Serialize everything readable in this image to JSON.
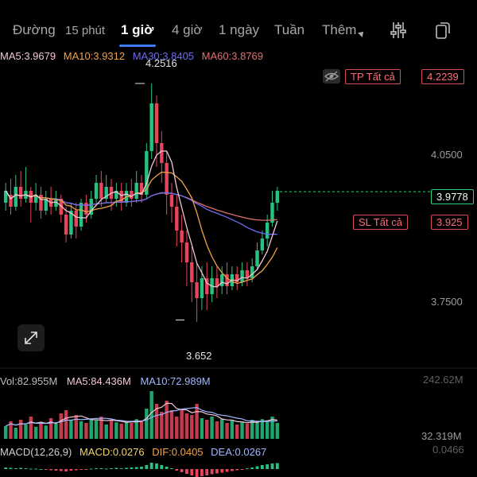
{
  "tabs": [
    {
      "label": "Đường",
      "active": false
    },
    {
      "label": "15 phút",
      "active": false
    },
    {
      "label": "1 giờ",
      "active": true
    },
    {
      "label": "4 giờ",
      "active": false
    },
    {
      "label": "1 ngày",
      "active": false
    },
    {
      "label": "Tuần",
      "active": false
    },
    {
      "label": "Thêm",
      "active": false
    }
  ],
  "toolbar_icons": [
    "indicator-settings-icon",
    "landscape-rotate-icon"
  ],
  "ma": {
    "ma5": "MA5:3.9679",
    "ma10": "MA10:3.9312",
    "ma30": "MA30:3.8405",
    "ma60": "MA60:3.8769"
  },
  "colors": {
    "up": "#26c281",
    "down": "#e8455a",
    "ma5": "#f2c7d6",
    "ma10": "#f0a347",
    "ma30": "#6f6cf0",
    "ma60": "#e06f6f",
    "accent": "#3d7bff",
    "current": "#2fd17c"
  },
  "orders": {
    "tp_label": "TP  Tất cả",
    "tp_price": "4.2239",
    "sl_label": "SL  Tất cả",
    "sl_price": "3.925"
  },
  "current_price": "3.9778",
  "price_axis": {
    "upper": "4.0500",
    "lower": "3.7500"
  },
  "high_label": "4.2516",
  "low_label": "3.652",
  "volume": {
    "vol": "Vol:82.955M",
    "ma5": "MA5:84.436M",
    "ma10": "MA10:72.989M",
    "axis_top": "242.62M",
    "axis_bottom": "32.319M"
  },
  "macd": {
    "label": "MACD(12,26,9)",
    "macd": "MACD:0.0276",
    "dif": "DIF:0.0405",
    "dea": "DEA:0.0267",
    "axis_top": "0.0466"
  },
  "chart_data": {
    "type": "candlestick",
    "y_range": [
      3.58,
      4.3
    ],
    "candles": [
      [
        3.95,
        3.98,
        3.93,
        4.0
      ],
      [
        3.97,
        3.94,
        3.92,
        4.01
      ],
      [
        3.94,
        3.99,
        3.93,
        4.02
      ],
      [
        3.99,
        3.96,
        3.94,
        4.03
      ],
      [
        3.96,
        3.98,
        3.95,
        4.04
      ],
      [
        3.98,
        3.95,
        3.9,
        3.99
      ],
      [
        3.95,
        3.97,
        3.93,
        4.0
      ],
      [
        3.97,
        3.93,
        3.91,
        3.99
      ],
      [
        3.93,
        3.96,
        3.92,
        3.98
      ],
      [
        3.96,
        3.94,
        3.92,
        3.99
      ],
      [
        3.94,
        3.96,
        3.93,
        3.98
      ],
      [
        3.96,
        3.92,
        3.9,
        3.97
      ],
      [
        3.92,
        3.87,
        3.85,
        3.94
      ],
      [
        3.87,
        3.93,
        3.86,
        3.95
      ],
      [
        3.93,
        3.89,
        3.86,
        3.95
      ],
      [
        3.89,
        3.95,
        3.88,
        3.96
      ],
      [
        3.95,
        3.92,
        3.9,
        3.97
      ],
      [
        3.92,
        3.96,
        3.91,
        3.98
      ],
      [
        3.96,
        4.0,
        3.95,
        4.02
      ],
      [
        4.0,
        3.96,
        3.94,
        4.03
      ],
      [
        3.96,
        3.99,
        3.95,
        4.02
      ],
      [
        3.99,
        3.96,
        3.93,
        4.01
      ],
      [
        3.96,
        3.98,
        3.94,
        4.0
      ],
      [
        3.98,
        3.95,
        3.93,
        4.0
      ],
      [
        3.95,
        3.98,
        3.94,
        4.0
      ],
      [
        3.98,
        3.96,
        3.94,
        4.01
      ],
      [
        3.96,
        4.0,
        3.95,
        4.03
      ],
      [
        4.0,
        3.97,
        3.95,
        4.02
      ],
      [
        3.97,
        4.08,
        3.96,
        4.1
      ],
      [
        4.08,
        4.2,
        4.06,
        4.25
      ],
      [
        4.2,
        4.1,
        4.04,
        4.22
      ],
      [
        4.1,
        4.05,
        4.0,
        4.13
      ],
      [
        4.05,
        3.97,
        3.92,
        4.08
      ],
      [
        3.97,
        3.94,
        3.9,
        4.0
      ],
      [
        3.94,
        3.88,
        3.84,
        3.97
      ],
      [
        3.88,
        3.85,
        3.8,
        3.92
      ],
      [
        3.85,
        3.8,
        3.74,
        3.88
      ],
      [
        3.8,
        3.75,
        3.7,
        3.84
      ],
      [
        3.75,
        3.71,
        3.65,
        3.8
      ],
      [
        3.71,
        3.76,
        3.68,
        3.79
      ],
      [
        3.76,
        3.72,
        3.68,
        3.8
      ],
      [
        3.72,
        3.76,
        3.7,
        3.79
      ],
      [
        3.76,
        3.74,
        3.71,
        3.79
      ],
      [
        3.74,
        3.77,
        3.72,
        3.79
      ],
      [
        3.77,
        3.74,
        3.72,
        3.8
      ],
      [
        3.74,
        3.77,
        3.73,
        3.79
      ],
      [
        3.77,
        3.75,
        3.73,
        3.79
      ],
      [
        3.75,
        3.78,
        3.74,
        3.8
      ],
      [
        3.78,
        3.76,
        3.74,
        3.8
      ],
      [
        3.76,
        3.79,
        3.75,
        3.81
      ],
      [
        3.79,
        3.83,
        3.78,
        3.85
      ],
      [
        3.83,
        3.86,
        3.82,
        3.88
      ],
      [
        3.86,
        3.9,
        3.84,
        3.92
      ],
      [
        3.9,
        3.95,
        3.89,
        3.98
      ],
      [
        3.95,
        3.98,
        3.93,
        3.99
      ]
    ],
    "volumes": [
      40,
      55,
      35,
      60,
      45,
      70,
      38,
      50,
      42,
      65,
      48,
      80,
      90,
      60,
      75,
      55,
      50,
      62,
      58,
      70,
      45,
      60,
      52,
      48,
      55,
      50,
      62,
      58,
      95,
      150,
      110,
      85,
      120,
      90,
      70,
      95,
      80,
      75,
      110,
      65,
      60,
      70,
      55,
      62,
      50,
      58,
      45,
      52,
      48,
      60,
      55,
      62,
      58,
      70,
      50
    ],
    "macd_hist": [
      0.004,
      0.003,
      0.002,
      0.003,
      0.002,
      0.001,
      0.001,
      0.0,
      -0.002,
      -0.003,
      -0.004,
      -0.005,
      -0.006,
      -0.004,
      -0.003,
      -0.002,
      -0.001,
      0.001,
      0.002,
      0.002,
      0.001,
      0.002,
      0.003,
      0.002,
      0.003,
      0.004,
      0.005,
      0.006,
      0.01,
      0.016,
      0.014,
      0.01,
      0.006,
      0.002,
      -0.004,
      -0.008,
      -0.012,
      -0.016,
      -0.02,
      -0.018,
      -0.016,
      -0.013,
      -0.011,
      -0.009,
      -0.007,
      -0.005,
      -0.003,
      -0.001,
      0.002,
      0.004,
      0.007,
      0.01,
      0.012,
      0.014,
      0.015
    ]
  }
}
